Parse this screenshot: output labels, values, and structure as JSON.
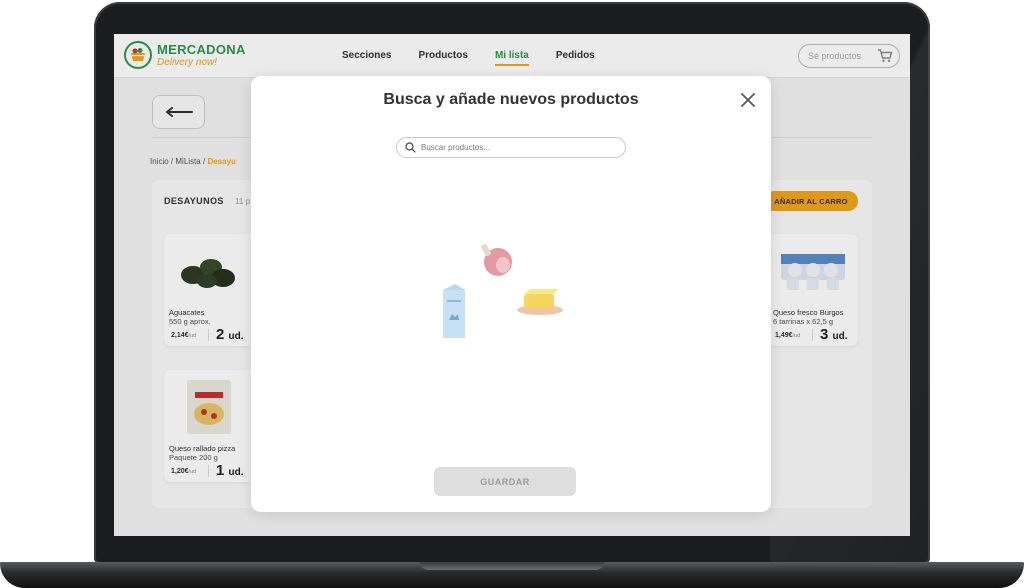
{
  "app": {
    "brand_name": "MERCADONA",
    "brand_tagline": "Delivery now!"
  },
  "nav": {
    "items": [
      {
        "label": "Secciones",
        "active": false
      },
      {
        "label": "Productos",
        "active": false
      },
      {
        "label": "Mi lista",
        "active": true
      },
      {
        "label": "Pedidos",
        "active": false
      }
    ]
  },
  "header_search": {
    "placeholder": "Sé productos"
  },
  "breadcrumb": {
    "items": [
      "Inicio",
      "MiLista",
      "Desayu"
    ],
    "separator": "/"
  },
  "list": {
    "title": "DESAYUNOS",
    "count": "11 p",
    "add_to_cart_label": "AÑADIR AL CARRO",
    "products": [
      {
        "name": "Aguacates",
        "detail": "550 g aprox.",
        "price": "2,14€",
        "price_unit": "/ud",
        "qty": "2",
        "qty_unit": "ud."
      },
      {
        "name": "Queso fresco Burgos",
        "detail": "6 tarrinas x 62,5 g",
        "price": "1,49€",
        "price_unit": "/ud",
        "qty": "3",
        "qty_unit": "ud."
      },
      {
        "name": "Queso rallado pizza",
        "detail": "Paquete 200 g",
        "price": "1,20€",
        "price_unit": "/ud",
        "qty": "1",
        "qty_unit": "ud."
      }
    ]
  },
  "modal": {
    "title": "Busca y añade nuevos productos",
    "search_placeholder": "Buscar productos...",
    "save_label": "GUARDAR",
    "save_enabled": false
  },
  "colors": {
    "brand_green": "#2d9b4a",
    "accent_orange": "#f2a51a",
    "disabled_gray": "#dedede"
  }
}
